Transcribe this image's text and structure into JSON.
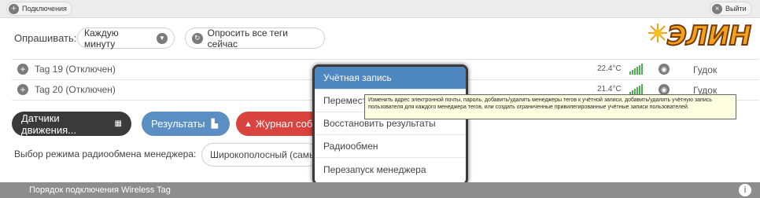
{
  "topbar": {
    "left_label": "Подключения",
    "right_label": "Выйти"
  },
  "logo": {
    "text": "ЭЛИН"
  },
  "poll": {
    "label": "Опрашивать:",
    "interval": "Каждую минуту",
    "all_button": "Опросить все теги сейчас"
  },
  "tags": [
    {
      "name": "Tag 19 (Отключен)",
      "temp": "22.4°C",
      "action": "Гудок"
    },
    {
      "name": "Tag 20 (Отключен)",
      "temp": "21.4°C",
      "action": "Гудок"
    }
  ],
  "buttons": {
    "motion": "Датчики движения...",
    "results": "Результаты",
    "events": "Журнал событий"
  },
  "radio": {
    "label": "Выбор режима радиообмена менеджера:",
    "value": "Широкополосный (самый"
  },
  "menu": {
    "items": [
      "Учётная запись",
      "Переместить",
      "Восстановить результаты",
      "Радиообмен",
      "Перезапуск менеджера"
    ]
  },
  "tooltip": {
    "text": "Изменить адрес электронной почты, пароль, добавить/удалить менеджеры тегов к учётной записи, добавить/удалить учётную запись пользователя для каждого менеджера тегов, или создать ограниченные привилегированные учётные записи пользователей."
  },
  "footer": {
    "text": "Порядок подключения Wireless Tag"
  },
  "colors": {
    "menu_highlight": "#4f87c0",
    "results_btn": "#5b8fc3",
    "events_btn": "#d9443f",
    "motion_btn": "#3a3a3a",
    "footer": "#8d8d8d",
    "signal": "#4caf50"
  }
}
